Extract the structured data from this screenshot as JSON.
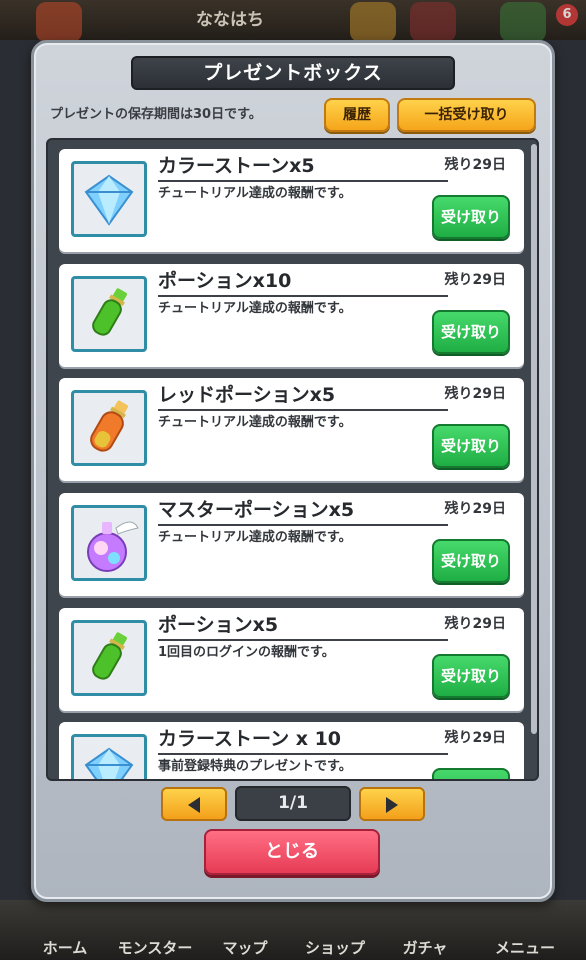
{
  "background": {
    "player_name": "ななはち",
    "badge_count": "6",
    "nav": [
      "ホーム",
      "モンスター",
      "マップ",
      "ショップ",
      "ガチャ",
      "メニュー"
    ]
  },
  "modal": {
    "title": "プレゼントボックス",
    "storage_note": "プレゼントの保存期間は30日です。",
    "history_label": "履歴",
    "receive_all_label": "一括受け取り",
    "receive_label": "受け取り",
    "close_label": "とじる",
    "page_indicator": "1/1"
  },
  "items": [
    {
      "name": "カラーストーンx5",
      "remaining": "残り29日",
      "desc": "チュートリアル達成の報酬です。",
      "icon": "diamond-icon"
    },
    {
      "name": "ポーションx10",
      "remaining": "残り29日",
      "desc": "チュートリアル達成の報酬です。",
      "icon": "green-potion-icon"
    },
    {
      "name": "レッドポーションx5",
      "remaining": "残り29日",
      "desc": "チュートリアル達成の報酬です。",
      "icon": "red-potion-icon"
    },
    {
      "name": "マスターポーションx5",
      "remaining": "残り29日",
      "desc": "チュートリアル達成の報酬です。",
      "icon": "master-potion-icon"
    },
    {
      "name": "ポーションx5",
      "remaining": "残り29日",
      "desc": "1回目のログインの報酬です。",
      "icon": "green-potion-icon"
    },
    {
      "name": "カラーストーン x 10",
      "remaining": "残り29日",
      "desc": "事前登録特典のプレゼントです。",
      "icon": "diamond-icon"
    }
  ],
  "colors": {
    "accent_orange": "#f5a51b",
    "receive_green": "#1fae45",
    "close_pink": "#e63b55",
    "thumb_border": "#2f8ea6"
  }
}
